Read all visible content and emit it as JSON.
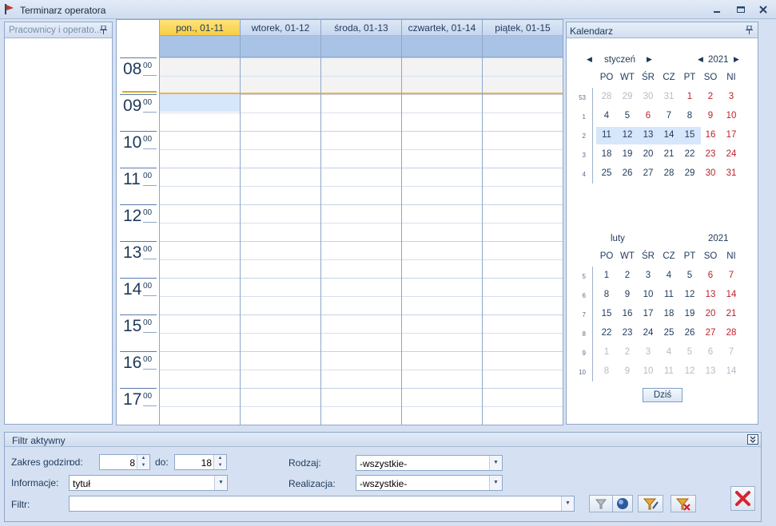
{
  "window": {
    "title": "Terminarz operatora"
  },
  "left_panel": {
    "title": "Pracownicy i operato..."
  },
  "scheduler": {
    "days": [
      {
        "label": "pon., 01-11",
        "today": true
      },
      {
        "label": "wtorek, 01-12",
        "today": false
      },
      {
        "label": "środa, 01-13",
        "today": false
      },
      {
        "label": "czwartek, 01-14",
        "today": false
      },
      {
        "label": "piątek, 01-15",
        "today": false
      }
    ],
    "hours": [
      "08",
      "09",
      "10",
      "11",
      "12",
      "13",
      "14",
      "15",
      "16",
      "17"
    ],
    "minutes": "00"
  },
  "calendar": {
    "title": "Kalendarz",
    "weekdays": [
      "PO",
      "WT",
      "ŚR",
      "CZ",
      "PT",
      "SO",
      "NI"
    ],
    "today_label": "Dziś",
    "months": [
      {
        "name": "styczeń",
        "year": "2021",
        "weeks": [
          {
            "wk": "53",
            "days": [
              "28",
              "29",
              "30",
              "31",
              "1",
              "2",
              "3"
            ],
            "grey": [
              0,
              1,
              2,
              3
            ],
            "hol": [
              4
            ]
          },
          {
            "wk": "1",
            "days": [
              "4",
              "5",
              "6",
              "7",
              "8",
              "9",
              "10"
            ],
            "grey": [],
            "hol": [
              2
            ]
          },
          {
            "wk": "2",
            "days": [
              "11",
              "12",
              "13",
              "14",
              "15",
              "16",
              "17"
            ],
            "grey": [],
            "hol": [],
            "selected": true
          },
          {
            "wk": "3",
            "days": [
              "18",
              "19",
              "20",
              "21",
              "22",
              "23",
              "24"
            ],
            "grey": [],
            "hol": []
          },
          {
            "wk": "4",
            "days": [
              "25",
              "26",
              "27",
              "28",
              "29",
              "30",
              "31"
            ],
            "grey": [],
            "hol": []
          }
        ]
      },
      {
        "name": "luty",
        "year": "2021",
        "weeks": [
          {
            "wk": "5",
            "days": [
              "1",
              "2",
              "3",
              "4",
              "5",
              "6",
              "7"
            ],
            "grey": [],
            "hol": []
          },
          {
            "wk": "6",
            "days": [
              "8",
              "9",
              "10",
              "11",
              "12",
              "13",
              "14"
            ],
            "grey": [],
            "hol": []
          },
          {
            "wk": "7",
            "days": [
              "15",
              "16",
              "17",
              "18",
              "19",
              "20",
              "21"
            ],
            "grey": [],
            "hol": []
          },
          {
            "wk": "8",
            "days": [
              "22",
              "23",
              "24",
              "25",
              "26",
              "27",
              "28"
            ],
            "grey": [],
            "hol": []
          },
          {
            "wk": "9",
            "days": [
              "1",
              "2",
              "3",
              "4",
              "5",
              "6",
              "7"
            ],
            "grey": [
              0,
              1,
              2,
              3,
              4,
              5,
              6
            ],
            "hol": []
          },
          {
            "wk": "10",
            "days": [
              "8",
              "9",
              "10",
              "11",
              "12",
              "13",
              "14"
            ],
            "grey": [
              0,
              1,
              2,
              3,
              4,
              5,
              6
            ],
            "hol": []
          }
        ]
      }
    ]
  },
  "filter": {
    "title": "Filtr aktywny",
    "zakres_label": "Zakres godzin",
    "od_label": "od:",
    "od_value": "8",
    "do_label": "do:",
    "do_value": "18",
    "informacje_label": "Informacje:",
    "informacje_value": "tytuł",
    "filtr_label": "Filtr:",
    "filtr_value": "",
    "rodzaj_label": "Rodzaj:",
    "rodzaj_value": "-wszystkie-",
    "realizacja_label": "Realizacja:",
    "realizacja_value": "-wszystkie-"
  },
  "icons": {
    "filter": "funnel-icon",
    "apply": "sphere-icon",
    "filter_edit": "funnel-pencil-icon",
    "filter_clear": "funnel-x-icon",
    "close": "red-x-icon"
  }
}
